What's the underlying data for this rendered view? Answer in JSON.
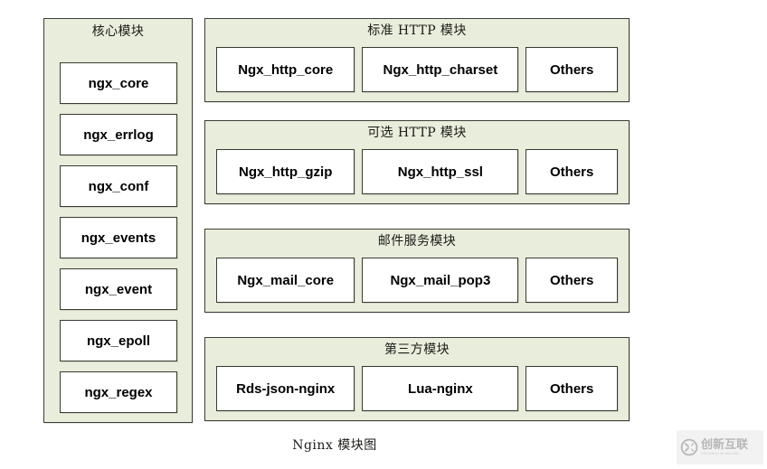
{
  "diagram": {
    "caption": "Nginx 模块图",
    "core_group": {
      "title": "核心模块",
      "modules": [
        {
          "label": "ngx_core"
        },
        {
          "label": "ngx_errlog"
        },
        {
          "label": "ngx_conf"
        },
        {
          "label": "ngx_events"
        },
        {
          "label": "ngx_event"
        },
        {
          "label": "ngx_epoll"
        },
        {
          "label": "ngx_regex"
        }
      ]
    },
    "groups": [
      {
        "title": "标准 HTTP 模块",
        "modules": [
          {
            "label": "Ngx_http_core"
          },
          {
            "label": "Ngx_http_charset"
          },
          {
            "label": "Others"
          }
        ]
      },
      {
        "title": "可选 HTTP 模块",
        "modules": [
          {
            "label": "Ngx_http_gzip"
          },
          {
            "label": "Ngx_http_ssl"
          },
          {
            "label": "Others"
          }
        ]
      },
      {
        "title": "邮件服务模块",
        "modules": [
          {
            "label": "Ngx_mail_core"
          },
          {
            "label": "Ngx_mail_pop3"
          },
          {
            "label": "Others"
          }
        ]
      },
      {
        "title": "第三方模块",
        "modules": [
          {
            "label": "Rds-json-nginx"
          },
          {
            "label": "Lua-nginx"
          },
          {
            "label": "Others"
          }
        ]
      }
    ]
  },
  "watermark": {
    "logo_icon": "circled-x-icon",
    "text": "创新互联",
    "subtext": "CHUANGXIN HULIAN"
  },
  "colors": {
    "panel_fill": "#e9eddb",
    "panel_border": "#3d3d36",
    "box_fill": "#ffffff",
    "box_border": "#3a3a33",
    "page_background": "#ffffff",
    "text": "#000000"
  }
}
